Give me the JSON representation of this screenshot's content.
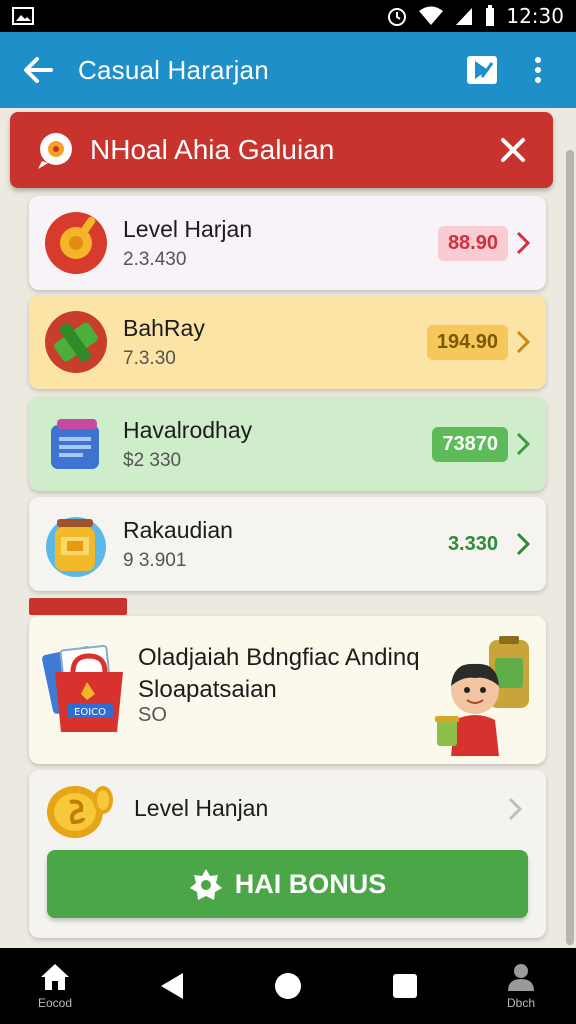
{
  "status_bar": {
    "time": "12:30",
    "icons": [
      "image-icon",
      "alarm-icon",
      "wifi-icon",
      "signal-icon",
      "battery-icon"
    ]
  },
  "app_bar": {
    "title": "Casual Hararjan",
    "icons": [
      "back-arrow-icon",
      "share-icon",
      "more-vert-icon"
    ]
  },
  "banner": {
    "title": "NHoal Ahia Galuian",
    "icon": "chat-bubble-icon",
    "color": "#c8342d"
  },
  "items": [
    {
      "name": "Level Harjan",
      "sub": "2.3.430",
      "value": "88.90",
      "value_color": "#d32f3c",
      "value_bg": "#f9cbd2",
      "icon": "gear-coin-icon"
    },
    {
      "name": "BahRay",
      "sub": "7.3.30",
      "value": "194.90",
      "value_color": "#7a5a00",
      "value_bg": "#f6c75a",
      "icon": "green-block-icon"
    },
    {
      "name": "Havalrodhay",
      "sub": "$2 330",
      "value": "73870",
      "value_color": "#ffffff",
      "value_bg": "#5dbb59",
      "icon": "blue-box-icon"
    },
    {
      "name": "Rakaudian",
      "sub": "9 3.901",
      "value": "3.330",
      "value_color": "#2e8b34",
      "value_bg": "transparent",
      "icon": "honey-jar-icon"
    }
  ],
  "promo": {
    "line1": "Oladjaiah Bdngfiac Andinq",
    "line2": "Sloapatsaian",
    "line3": "SO",
    "bag_label": "EOICO",
    "icons": [
      "shopping-bag-icon",
      "character-icon"
    ]
  },
  "level_card": {
    "label": "Level Hanjan",
    "icon": "gold-coin-icon"
  },
  "bonus_button": {
    "label": "HAI BONUS",
    "icon": "star-badge-icon",
    "color": "#4aa646"
  },
  "nav": {
    "home_label": "Eocod",
    "profile_label": "Dbch"
  }
}
